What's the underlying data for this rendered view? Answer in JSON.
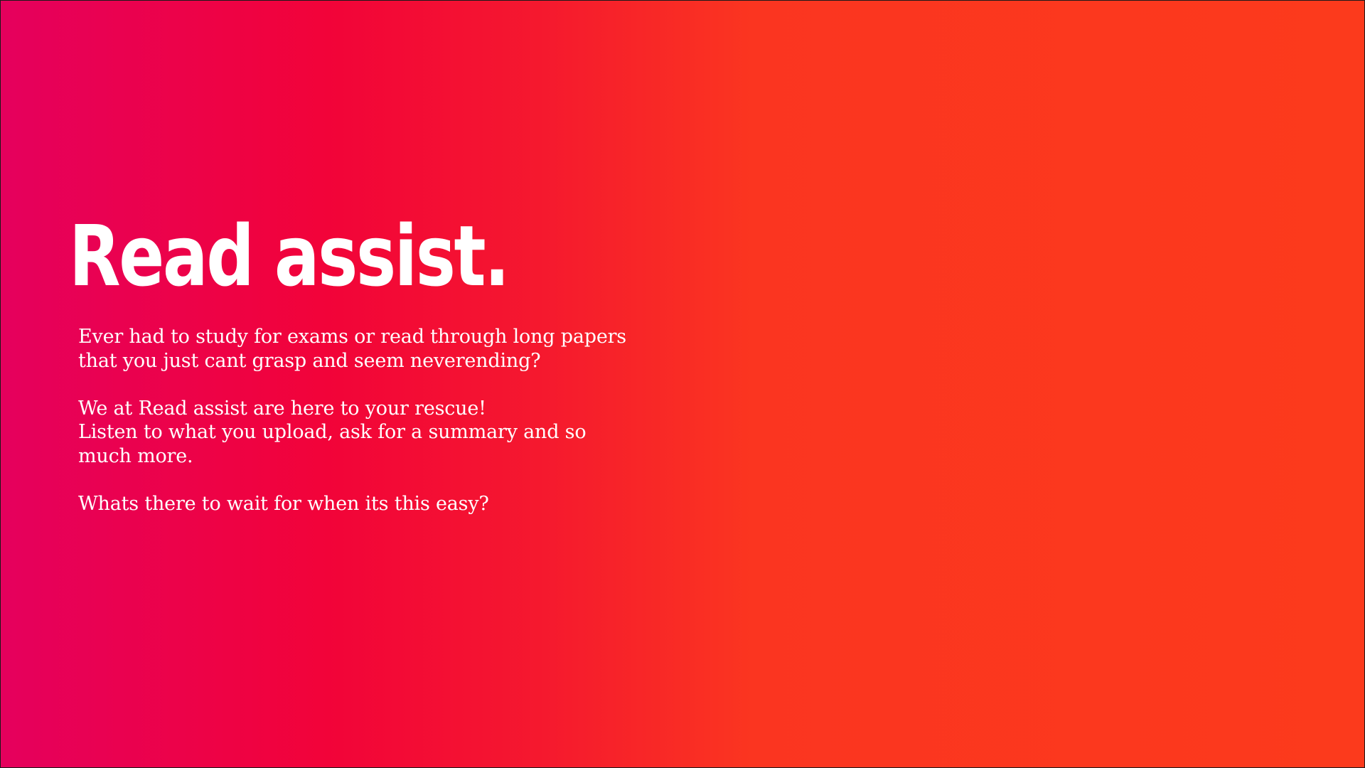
{
  "slide": {
    "title": "Read assist.",
    "paragraphs": [
      {
        "lines": [
          "Ever had to study for exams or read through long papers",
          "that you just cant grasp and seem neverending?"
        ]
      },
      {
        "lines": [
          "We at Read assist are here to your rescue!",
          "Listen to what you upload, ask for a summary and so",
          "much more."
        ]
      },
      {
        "lines": [
          "Whats there to wait for when its this easy?"
        ]
      }
    ]
  },
  "colors": {
    "gradient_start": "#e5005d",
    "gradient_mid": "#f20339",
    "gradient_end": "#fc3a1c",
    "text": "#ffffff"
  }
}
